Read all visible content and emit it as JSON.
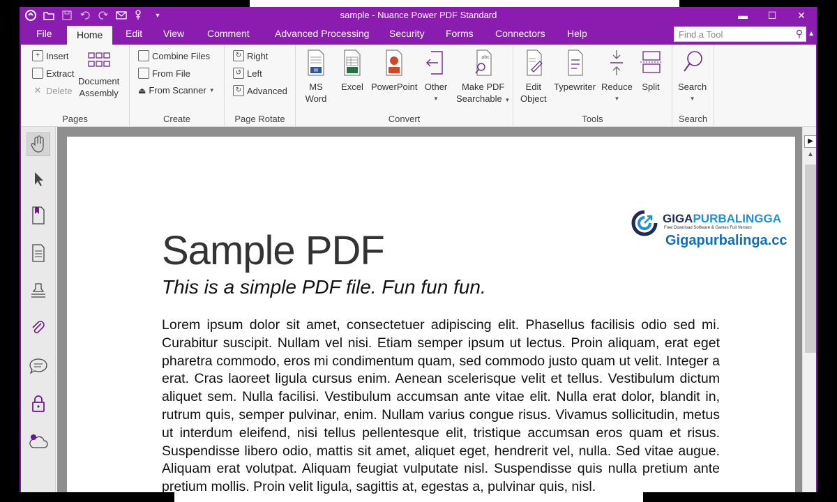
{
  "window": {
    "title": "sample - Nuance Power PDF Standard"
  },
  "menu": {
    "tabs": [
      "File",
      "Home",
      "Edit",
      "View",
      "Comment",
      "Advanced Processing",
      "Security",
      "Forms",
      "Connectors",
      "Help"
    ],
    "active_tab": "Home",
    "find_placeholder": "Find a Tool"
  },
  "ribbon": {
    "pages": {
      "label": "Pages",
      "insert": "Insert",
      "extract": "Extract",
      "delete": "Delete",
      "doc_assembly_1": "Document",
      "doc_assembly_2": "Assembly"
    },
    "create": {
      "label": "Create",
      "combine": "Combine Files",
      "from_file": "From File",
      "from_scanner": "From Scanner"
    },
    "rotate": {
      "label": "Page Rotate",
      "right": "Right",
      "left": "Left",
      "advanced": "Advanced"
    },
    "convert": {
      "label": "Convert",
      "word_1": "MS",
      "word_2": "Word",
      "excel": "Excel",
      "powerpoint": "PowerPoint",
      "other": "Other",
      "searchable_1": "Make PDF",
      "searchable_2": "Searchable"
    },
    "tools": {
      "label": "Tools",
      "edit_1": "Edit",
      "edit_2": "Object",
      "typewriter": "Typewriter",
      "reduce": "Reduce",
      "split": "Split"
    },
    "search": {
      "label": "Search",
      "search": "Search"
    }
  },
  "document": {
    "title": "Sample PDF",
    "subtitle": "This is a simple PDF file. Fun fun fun.",
    "body": "Lorem ipsum dolor sit amet, consectetuer adipiscing elit. Phasellus facilisis odio sed mi. Curabitur suscipit. Nullam vel nisi. Etiam semper ipsum ut lectus. Proin aliquam, erat eget pharetra commodo, eros mi condimentum quam, sed commodo justo quam ut velit. Integer a erat. Cras laoreet ligula cursus enim. Aenean scelerisque velit et tellus. Vestibulum dictum aliquet sem. Nulla facilisi. Vestibulum accumsan ante vitae elit. Nulla erat dolor, blandit in, rutrum quis, semper pulvinar, enim. Nullam varius congue risus. Vivamus sollicitudin, metus ut interdum eleifend, nisi tellus pellentesque elit, tristique accumsan eros quam et risus. Suspendisse libero odio, mattis sit amet, aliquet eget, hendrerit vel, nulla. Sed vitae augue. Aliquam erat volutpat. Aliquam feugiat vulputate nisl. Suspendisse quis nulla pretium ante pretium mollis. Proin velit ligula, sagittis at, egestas a, pulvinar quis, nisl."
  },
  "watermark": {
    "brand_a": "GIGA",
    "brand_b": "PURBALINGGA",
    "tagline": "Free Download Software & Games Full Version",
    "site": "Gigapurbalinga.cc"
  },
  "colors": {
    "accent": "#8a1cb0"
  }
}
